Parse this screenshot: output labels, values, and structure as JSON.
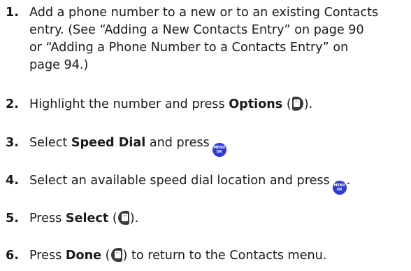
{
  "steps": [
    {
      "number": "1.",
      "lines": [
        "Add a phone number to a new or to an existing Contacts",
        "entry. (See “Adding a New Contacts Entry” on page 90",
        "or “Adding a Phone Number to a Contacts Entry” on",
        "page 94.)"
      ]
    },
    {
      "number": "2.",
      "pre": "Highlight the number and press ",
      "bold": "Options",
      "open": " (",
      "close": ")."
    },
    {
      "number": "3.",
      "pre": "Select ",
      "bold": "Speed Dial",
      "post": " and press"
    },
    {
      "number": "4.",
      "pre": "Select an available speed dial location and press",
      "post": "."
    },
    {
      "number": "5.",
      "pre": "Press ",
      "bold": "Select",
      "open": " (",
      "close": ")."
    },
    {
      "number": "6.",
      "pre": "Press ",
      "bold": "Done",
      "open": " (",
      "close": ") to return to the Contacts menu."
    }
  ],
  "icons": {
    "softkey_dots": "···",
    "menu_ok_top": "MENU",
    "menu_ok_bottom": "OK",
    "menu_ok_color": "#2d3bd6"
  }
}
